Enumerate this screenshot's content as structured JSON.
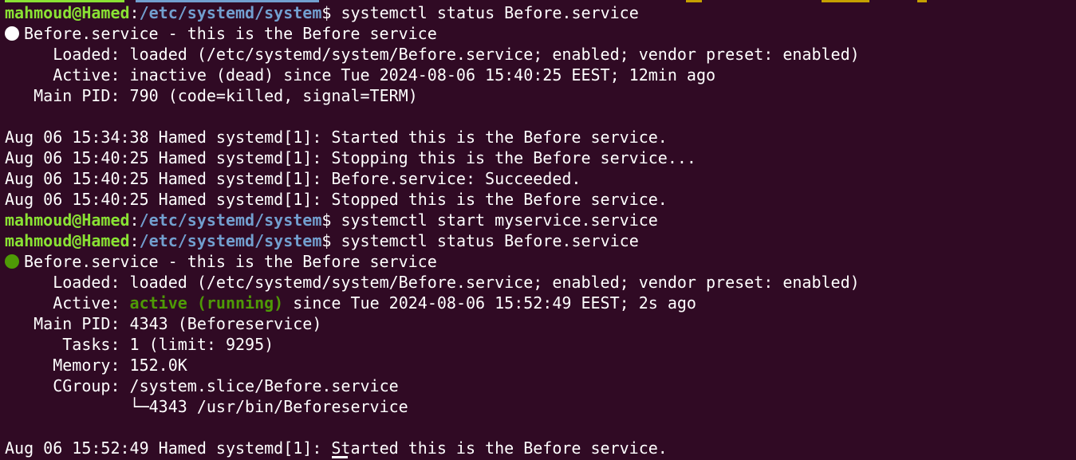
{
  "prompt": {
    "user_host": "mahmoud@Hamed",
    "sep": ":",
    "path": "/etc/systemd/system",
    "symbol": "$"
  },
  "block1": {
    "command": " systemctl status Before.service",
    "header": "Before.service - this is the Before service",
    "loaded": "     Loaded: loaded (/etc/systemd/system/Before.service; enabled; vendor preset: enabled)",
    "active": "     Active: inactive (dead) since Tue 2024-08-06 15:40:25 EEST; 12min ago",
    "mainpid": "   Main PID: 790 (code=killed, signal=TERM)",
    "logs": [
      "Aug 06 15:34:38 Hamed systemd[1]: Started this is the Before service.",
      "Aug 06 15:40:25 Hamed systemd[1]: Stopping this is the Before service...",
      "Aug 06 15:40:25 Hamed systemd[1]: Before.service: Succeeded.",
      "Aug 06 15:40:25 Hamed systemd[1]: Stopped this is the Before service."
    ]
  },
  "cmd_start": " systemctl start myservice.service",
  "block2": {
    "command": " systemctl status Before.service",
    "header": "Before.service - this is the Before service",
    "loaded": "     Loaded: loaded (/etc/systemd/system/Before.service; enabled; vendor preset: enabled)",
    "active_label": "     Active: ",
    "active_state": "active (running)",
    "active_rest": " since Tue 2024-08-06 15:52:49 EEST; 2s ago",
    "mainpid": "   Main PID: 4343 (Beforeservice)",
    "tasks": "      Tasks: 1 (limit: 9295)",
    "memory": "     Memory: 152.0K",
    "cgroup": "     CGroup: /system.slice/Before.service",
    "cgroup_child": "             └─4343 /usr/bin/Beforeservice",
    "logs": [
      "Aug 06 15:52:49 Hamed systemd[1]: Started this is the Before service."
    ]
  },
  "colors": {
    "background": "#300a24",
    "prompt_user": "#8ae234",
    "prompt_path": "#729fcf",
    "active_running": "#4e9a06"
  }
}
